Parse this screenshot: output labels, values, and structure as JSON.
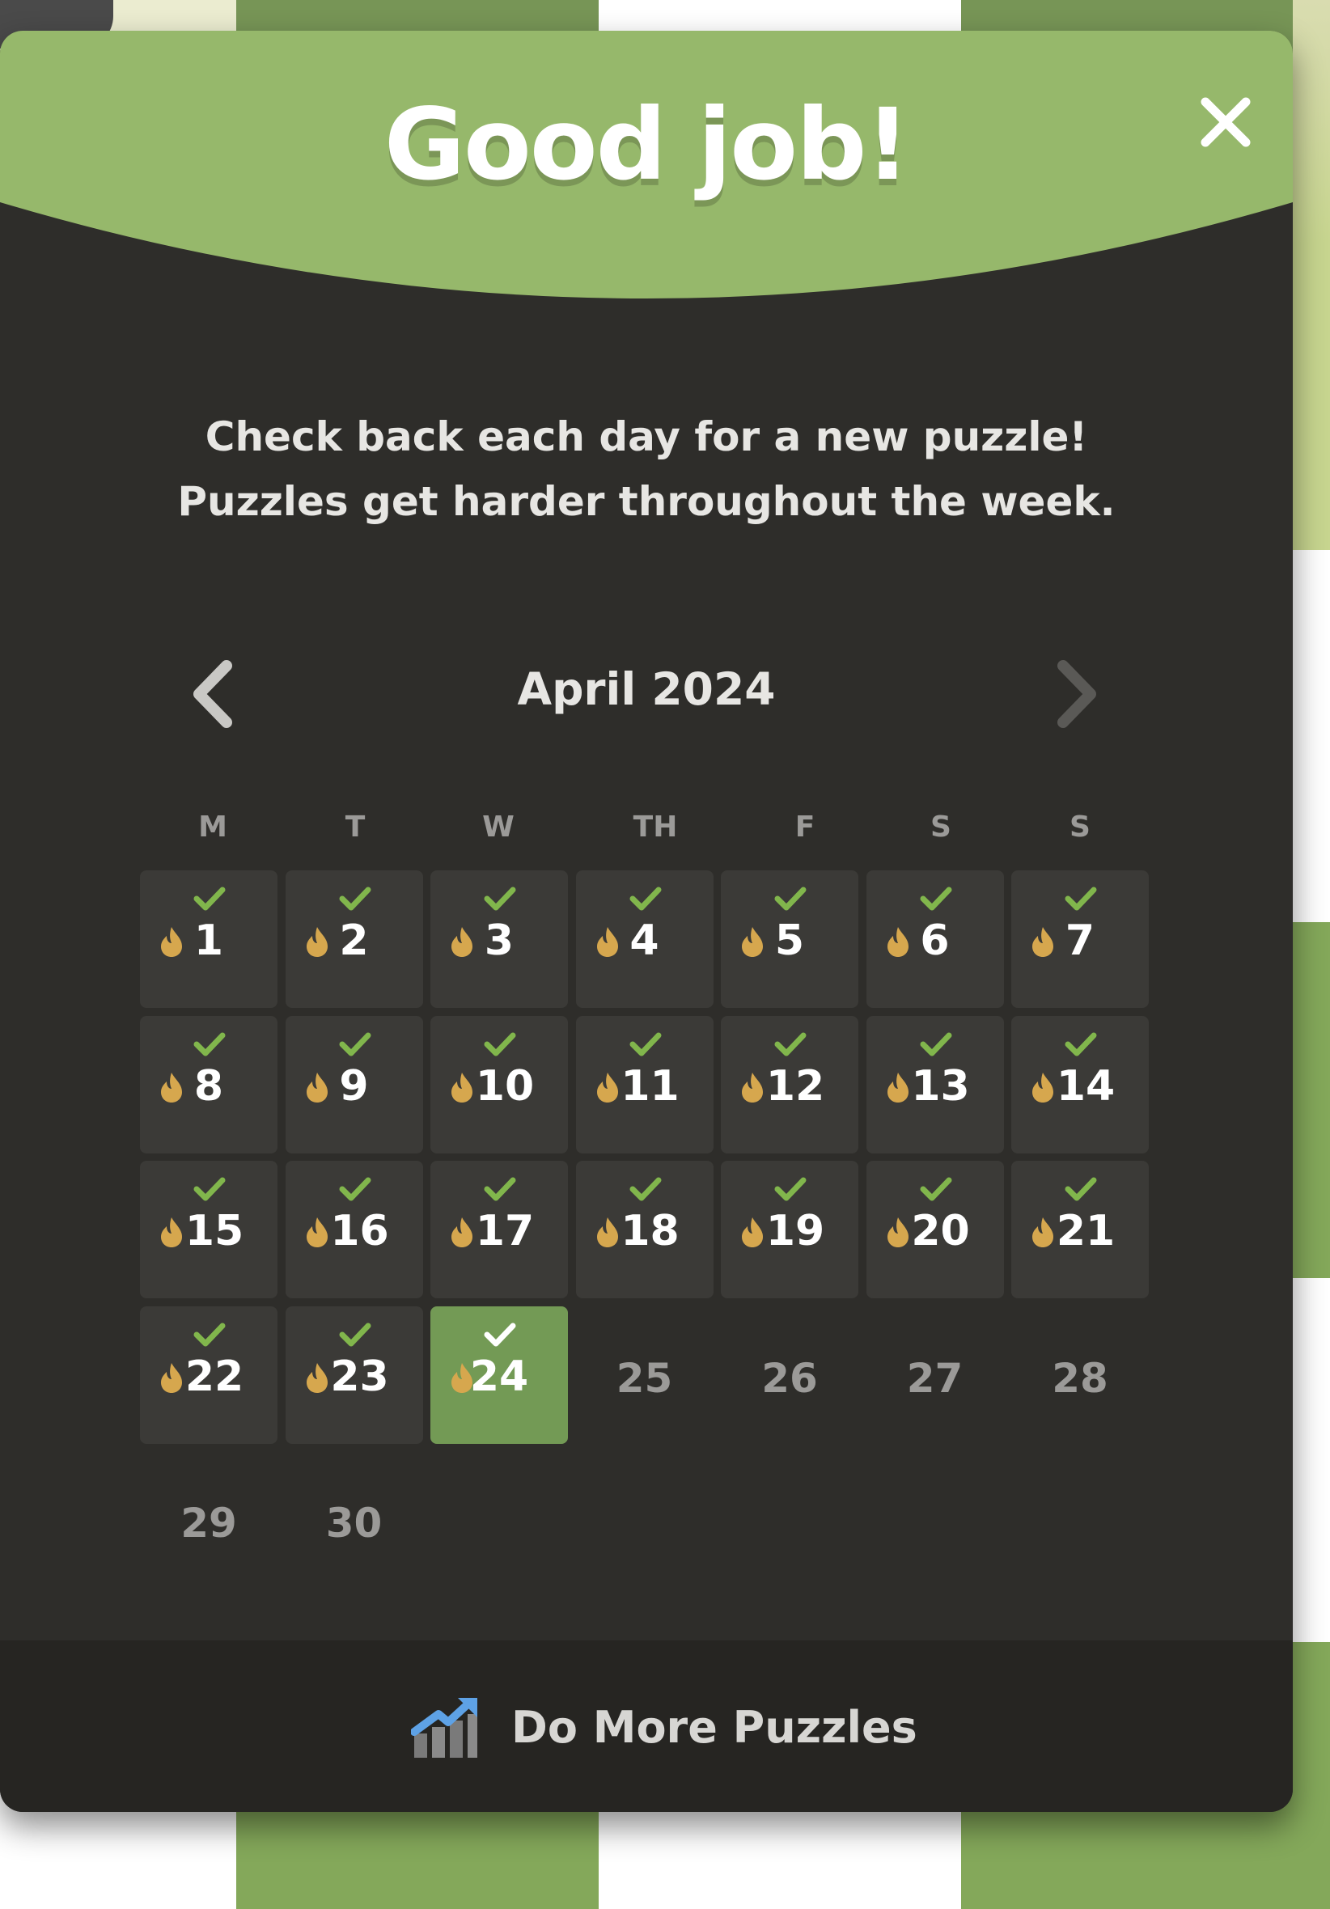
{
  "modal": {
    "title": "Good job!",
    "subtitle_line1": "Check back each day for a new puzzle!",
    "subtitle_line2": "Puzzles get harder throughout the week.",
    "close_icon": "close-icon"
  },
  "calendar": {
    "month_label": "April 2024",
    "prev_icon": "chevron-left-icon",
    "next_icon": "chevron-right-icon",
    "weekdays": [
      "M",
      "T",
      "W",
      "TH",
      "F",
      "S",
      "S"
    ],
    "days": [
      {
        "label": "1",
        "status": "solved"
      },
      {
        "label": "2",
        "status": "solved"
      },
      {
        "label": "3",
        "status": "solved"
      },
      {
        "label": "4",
        "status": "solved"
      },
      {
        "label": "5",
        "status": "solved"
      },
      {
        "label": "6",
        "status": "solved"
      },
      {
        "label": "7",
        "status": "solved"
      },
      {
        "label": "8",
        "status": "solved"
      },
      {
        "label": "9",
        "status": "solved"
      },
      {
        "label": "10",
        "status": "solved"
      },
      {
        "label": "11",
        "status": "solved"
      },
      {
        "label": "12",
        "status": "solved"
      },
      {
        "label": "13",
        "status": "solved"
      },
      {
        "label": "14",
        "status": "solved"
      },
      {
        "label": "15",
        "status": "solved"
      },
      {
        "label": "16",
        "status": "solved"
      },
      {
        "label": "17",
        "status": "solved"
      },
      {
        "label": "18",
        "status": "solved"
      },
      {
        "label": "19",
        "status": "solved"
      },
      {
        "label": "20",
        "status": "solved"
      },
      {
        "label": "21",
        "status": "solved"
      },
      {
        "label": "22",
        "status": "solved"
      },
      {
        "label": "23",
        "status": "solved"
      },
      {
        "label": "24",
        "status": "today"
      },
      {
        "label": "25",
        "status": "upcoming"
      },
      {
        "label": "26",
        "status": "upcoming"
      },
      {
        "label": "27",
        "status": "upcoming"
      },
      {
        "label": "28",
        "status": "upcoming"
      },
      {
        "label": "29",
        "status": "upcoming"
      },
      {
        "label": "30",
        "status": "upcoming"
      }
    ]
  },
  "footer": {
    "button_label": "Do More Puzzles",
    "button_icon": "trending-chart-icon"
  },
  "colors": {
    "header_green": "#96b86b",
    "modal_bg": "#2e2d2a",
    "cell_bg": "#3b3a37",
    "today_bg": "#739a55",
    "check_green": "#81b64c",
    "flame": "#d6a74e",
    "muted_text": "#9b9a98"
  }
}
